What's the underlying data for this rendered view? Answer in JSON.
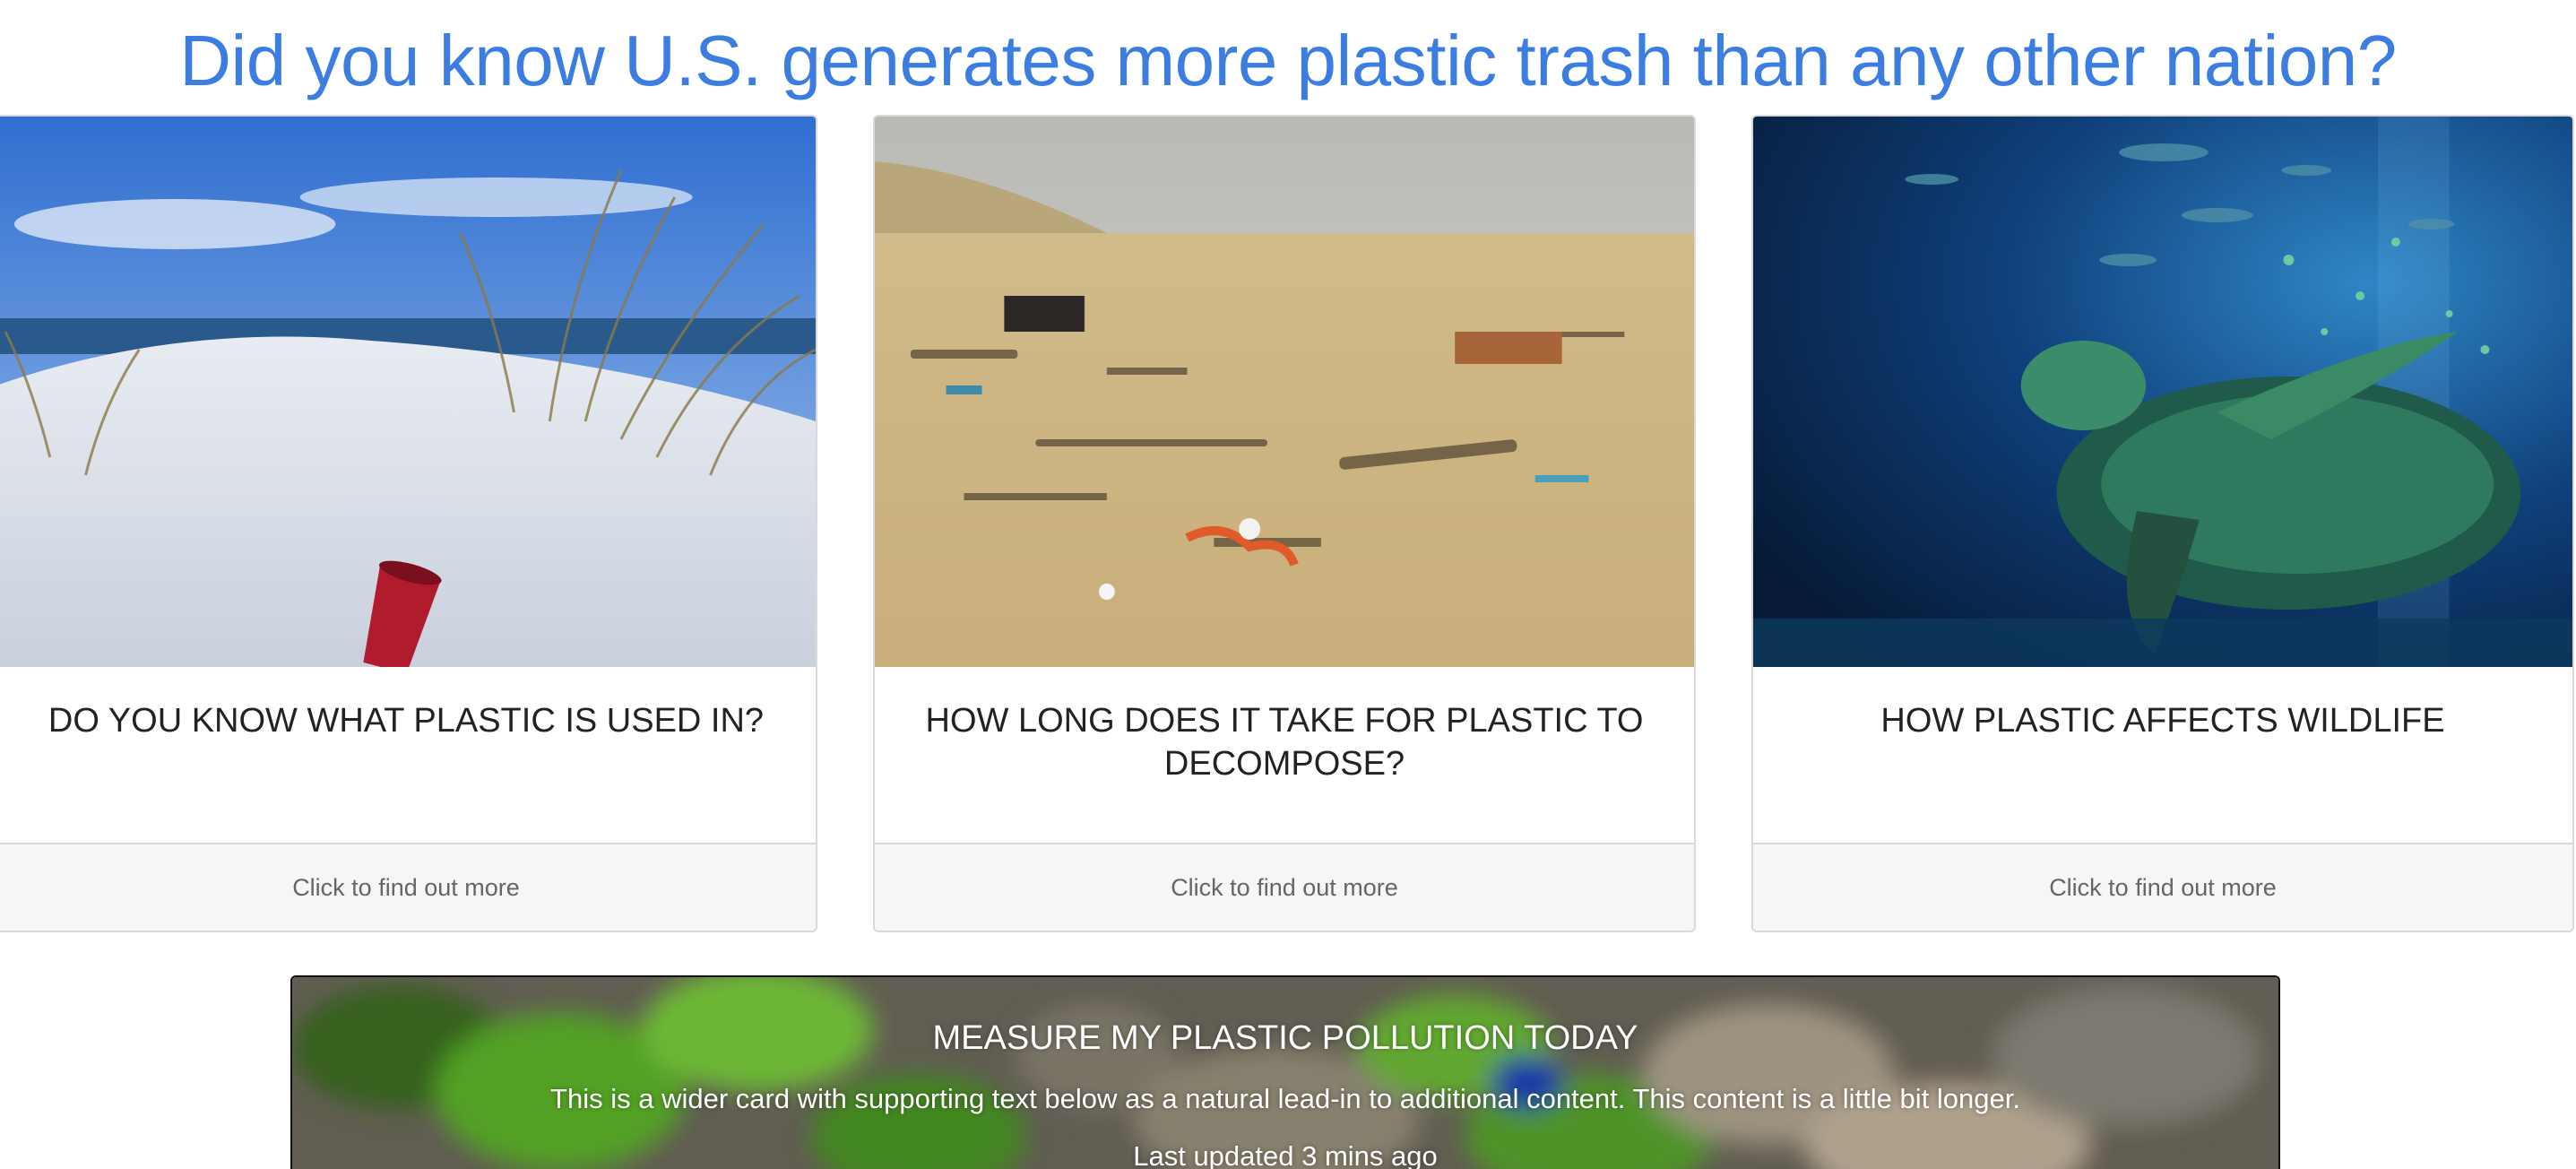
{
  "page": {
    "headline": "Did you know U.S. generates more plastic trash than any other nation?"
  },
  "cards": [
    {
      "title": "DO YOU KNOW WHAT PLASTIC IS USED IN?",
      "footer": "Click to find out more",
      "image": "red-plastic-cup-on-sand-dune"
    },
    {
      "title": "HOW LONG DOES IT TAKE FOR PLASTIC TO DECOMPOSE?",
      "footer": "Click to find out more",
      "image": "polluted-beach-debris"
    },
    {
      "title": "HOW PLASTIC AFFECTS WILDLIFE",
      "footer": "Click to find out more",
      "image": "sea-turtle-underwater"
    }
  ],
  "wide_card": {
    "title": "MEASURE MY PLASTIC POLLUTION TODAY",
    "text": "This is a wider card with supporting text below as a natural lead-in to additional content. This content is a little bit longer.",
    "updated": "Last updated 3 mins ago",
    "image": "blurred-green-leaves-on-polluted-shore"
  },
  "colors": {
    "headline": "#3b7de0",
    "card_border": "#d9d9d9",
    "footer_bg": "#f6f6f6"
  }
}
